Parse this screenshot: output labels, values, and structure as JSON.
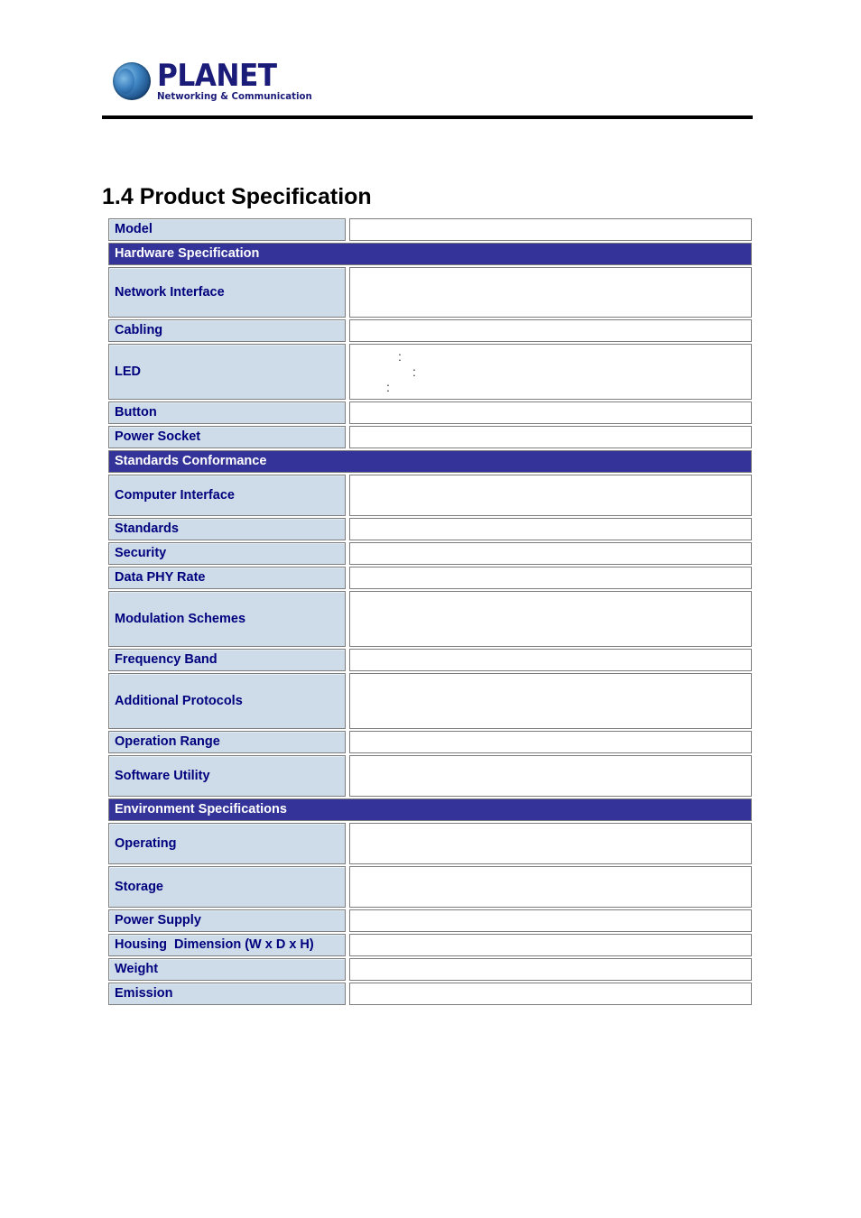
{
  "header": {
    "logo_brand": "PLANET",
    "logo_tagline": "Networking & Communication"
  },
  "heading": {
    "title": "1.4 Product Specification"
  },
  "table": {
    "rows": [
      {
        "kind": "spec",
        "label": "Model",
        "value": "",
        "height": "h-1"
      },
      {
        "kind": "section",
        "label": "Hardware Specification"
      },
      {
        "kind": "spec",
        "label": "Network Interface",
        "value": "",
        "height": "h-3"
      },
      {
        "kind": "spec",
        "label": "Cabling",
        "value": "",
        "height": "h-1"
      },
      {
        "kind": "led",
        "label": "LED",
        "value": "",
        "height": "h-5",
        "marks": [
          ":",
          ":",
          ":"
        ]
      },
      {
        "kind": "spec",
        "label": "Button",
        "value": "",
        "height": "h-1"
      },
      {
        "kind": "spec",
        "label": "Power Socket",
        "value": "",
        "height": "h-1"
      },
      {
        "kind": "section",
        "label": "Standards Conformance"
      },
      {
        "kind": "spec",
        "label": "Computer Interface",
        "value": "",
        "height": "h-4"
      },
      {
        "kind": "spec",
        "label": "Standards",
        "value": "",
        "height": "h-1"
      },
      {
        "kind": "spec",
        "label": "Security",
        "value": "",
        "height": "h-1"
      },
      {
        "kind": "spec",
        "label": "Data PHY Rate",
        "value": "",
        "height": "h-1"
      },
      {
        "kind": "spec",
        "label": "Modulation Schemes",
        "value": "",
        "height": "h-5"
      },
      {
        "kind": "spec",
        "label": "Frequency Band",
        "value": "",
        "height": "h-1"
      },
      {
        "kind": "spec",
        "label": "Additional Protocols",
        "value": "",
        "height": "h-5"
      },
      {
        "kind": "spec",
        "label": "Operation Range",
        "value": "",
        "height": "h-1"
      },
      {
        "kind": "spec",
        "label": "Software Utility",
        "value": "",
        "height": "h-4"
      },
      {
        "kind": "section",
        "label": "Environment Specifications"
      },
      {
        "kind": "spec",
        "label": "Operating",
        "value": "",
        "height": "h-4"
      },
      {
        "kind": "spec",
        "label": "Storage",
        "value": "",
        "height": "h-4"
      },
      {
        "kind": "spec",
        "label": "Power Supply",
        "value": "",
        "height": "h-1"
      },
      {
        "kind": "spec",
        "label": "Housing  Dimension (W x D x H)",
        "value": "",
        "height": "h-1"
      },
      {
        "kind": "spec",
        "label": "Weight",
        "value": "",
        "height": "h-1"
      },
      {
        "kind": "spec",
        "label": "Emission",
        "value": "",
        "height": "h-1"
      }
    ]
  },
  "colors": {
    "label_bg": "#cddce8",
    "label_text": "#00007e",
    "section_bg": "#33339a",
    "section_text": "#ffffff",
    "cell_border": "#7d7d7d",
    "rule": "#000000",
    "logo_blue": "#1b1b7a"
  }
}
